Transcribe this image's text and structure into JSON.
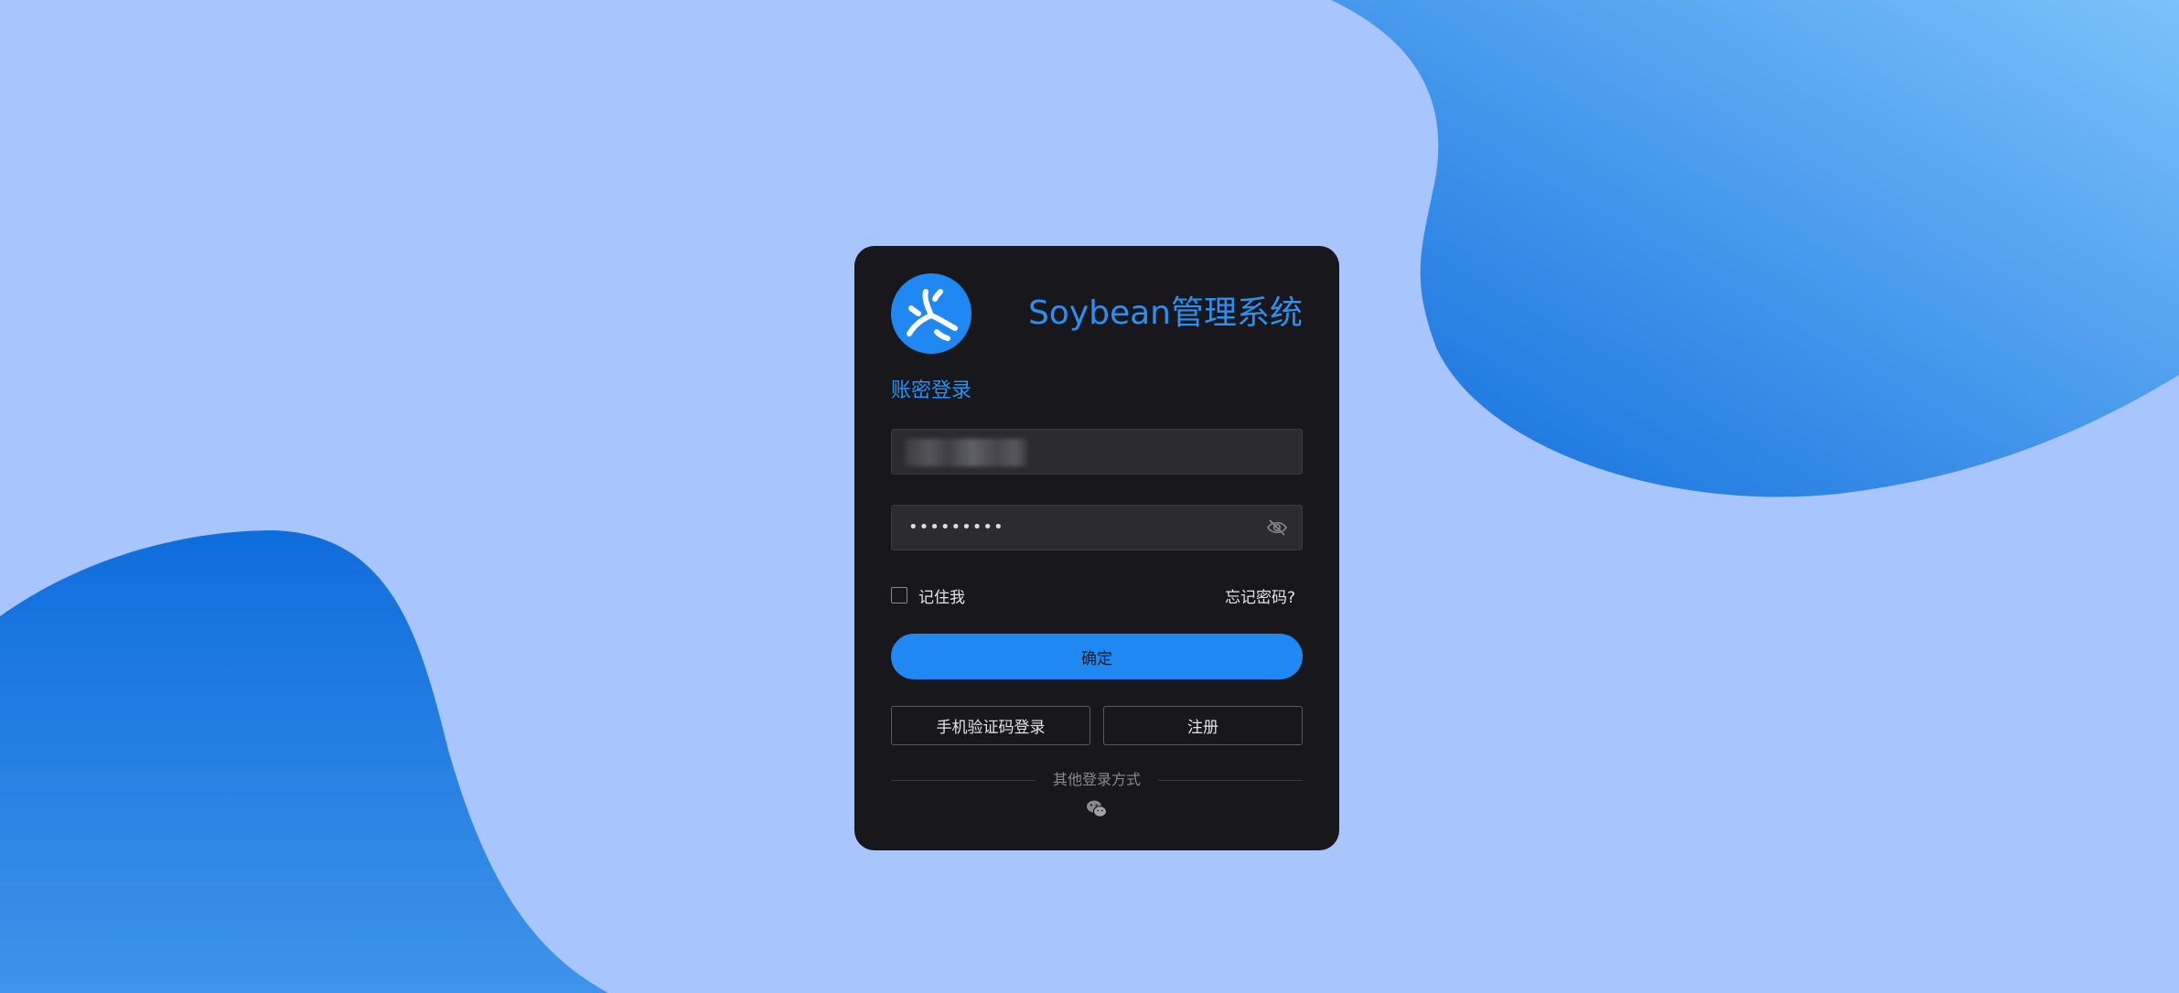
{
  "theme_toggle": {
    "icon": "moon-icon"
  },
  "header": {
    "logo_icon": "soybean-logo-icon",
    "title": "Soybean管理系统"
  },
  "login": {
    "mode_title": "账密登录",
    "username": {
      "value": "",
      "blurred": true
    },
    "password": {
      "value": "•••••••••",
      "toggle_icon": "eye-icon"
    },
    "remember_label": "记住我",
    "remember_checked": false,
    "forgot_label": "忘记密码?",
    "confirm_label": "确定",
    "phone_login_label": "手机验证码登录",
    "register_label": "注册",
    "other_methods_label": "其他登录方式",
    "other_methods_icons": [
      "wechat-icon"
    ]
  },
  "colors": {
    "background": "#a8c5fd",
    "blob_dark": "#0f6ddc",
    "blob_light": "#7ac2fa",
    "card": "#18181c",
    "accent": "#2088f2",
    "title": "#2d8ff0"
  }
}
